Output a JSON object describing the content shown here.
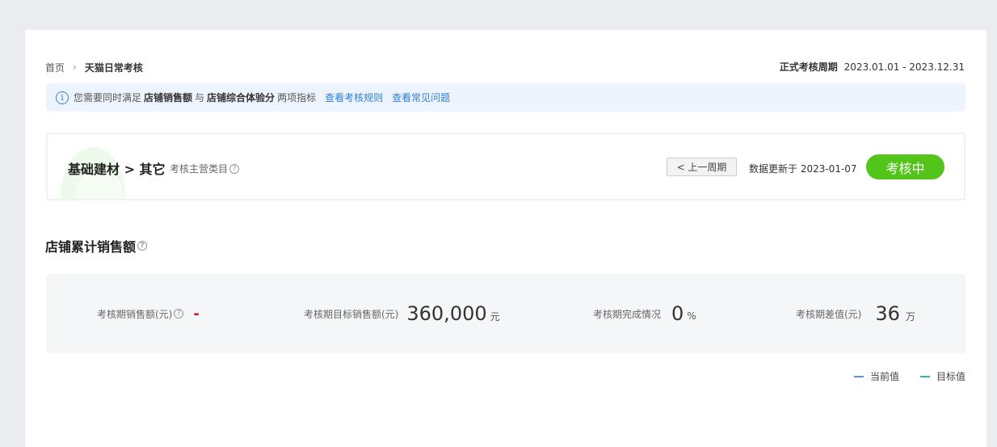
{
  "breadcrumb": {
    "home": "首页",
    "separator": ">",
    "current": "天猫日常考核"
  },
  "period": {
    "label": "正式考核周期",
    "range": "2023.01.01 - 2023.12.31"
  },
  "notice": {
    "icon": "i",
    "prefix": "您需要同时满足",
    "metric1": "店铺销售额",
    "conjunction": "与",
    "metric2": "店铺综合体验分",
    "suffix": "两项指标",
    "link_rules": "查看考核规则",
    "link_faq": "查看常见问题"
  },
  "category": {
    "title": "基础建材 > 其它",
    "subtitle": "考核主营类目",
    "prev_button": "< 上一周期",
    "update_text": "数据更新于 2023-01-07",
    "status": "考核中"
  },
  "section": {
    "title": "店铺累计销售额"
  },
  "metrics": {
    "sales": {
      "label": "考核期销售额(元)",
      "value": "-"
    },
    "target": {
      "label": "考核期目标销售额(元)",
      "value": "360,000",
      "unit": "元"
    },
    "completion": {
      "label": "考核期完成情况",
      "value": "0",
      "unit": "%"
    },
    "gap": {
      "label": "考核期差值(元)",
      "value": "36",
      "unit": "万"
    }
  },
  "legend": {
    "current": {
      "label": "当前值",
      "color": "#5b8ff9"
    },
    "target": {
      "label": "目标值",
      "color": "#2fb8a6"
    }
  },
  "help_icon": "?"
}
